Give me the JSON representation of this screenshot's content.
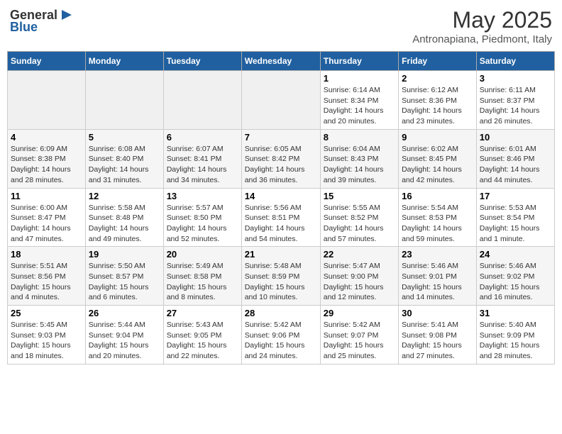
{
  "logo": {
    "line1": "General",
    "line2": "Blue"
  },
  "title": "May 2025",
  "subtitle": "Antronapiana, Piedmont, Italy",
  "weekdays": [
    "Sunday",
    "Monday",
    "Tuesday",
    "Wednesday",
    "Thursday",
    "Friday",
    "Saturday"
  ],
  "weeks": [
    [
      {
        "day": "",
        "info": ""
      },
      {
        "day": "",
        "info": ""
      },
      {
        "day": "",
        "info": ""
      },
      {
        "day": "",
        "info": ""
      },
      {
        "day": "1",
        "info": "Sunrise: 6:14 AM\nSunset: 8:34 PM\nDaylight: 14 hours and 20 minutes."
      },
      {
        "day": "2",
        "info": "Sunrise: 6:12 AM\nSunset: 8:36 PM\nDaylight: 14 hours and 23 minutes."
      },
      {
        "day": "3",
        "info": "Sunrise: 6:11 AM\nSunset: 8:37 PM\nDaylight: 14 hours and 26 minutes."
      }
    ],
    [
      {
        "day": "4",
        "info": "Sunrise: 6:09 AM\nSunset: 8:38 PM\nDaylight: 14 hours and 28 minutes."
      },
      {
        "day": "5",
        "info": "Sunrise: 6:08 AM\nSunset: 8:40 PM\nDaylight: 14 hours and 31 minutes."
      },
      {
        "day": "6",
        "info": "Sunrise: 6:07 AM\nSunset: 8:41 PM\nDaylight: 14 hours and 34 minutes."
      },
      {
        "day": "7",
        "info": "Sunrise: 6:05 AM\nSunset: 8:42 PM\nDaylight: 14 hours and 36 minutes."
      },
      {
        "day": "8",
        "info": "Sunrise: 6:04 AM\nSunset: 8:43 PM\nDaylight: 14 hours and 39 minutes."
      },
      {
        "day": "9",
        "info": "Sunrise: 6:02 AM\nSunset: 8:45 PM\nDaylight: 14 hours and 42 minutes."
      },
      {
        "day": "10",
        "info": "Sunrise: 6:01 AM\nSunset: 8:46 PM\nDaylight: 14 hours and 44 minutes."
      }
    ],
    [
      {
        "day": "11",
        "info": "Sunrise: 6:00 AM\nSunset: 8:47 PM\nDaylight: 14 hours and 47 minutes."
      },
      {
        "day": "12",
        "info": "Sunrise: 5:58 AM\nSunset: 8:48 PM\nDaylight: 14 hours and 49 minutes."
      },
      {
        "day": "13",
        "info": "Sunrise: 5:57 AM\nSunset: 8:50 PM\nDaylight: 14 hours and 52 minutes."
      },
      {
        "day": "14",
        "info": "Sunrise: 5:56 AM\nSunset: 8:51 PM\nDaylight: 14 hours and 54 minutes."
      },
      {
        "day": "15",
        "info": "Sunrise: 5:55 AM\nSunset: 8:52 PM\nDaylight: 14 hours and 57 minutes."
      },
      {
        "day": "16",
        "info": "Sunrise: 5:54 AM\nSunset: 8:53 PM\nDaylight: 14 hours and 59 minutes."
      },
      {
        "day": "17",
        "info": "Sunrise: 5:53 AM\nSunset: 8:54 PM\nDaylight: 15 hours and 1 minute."
      }
    ],
    [
      {
        "day": "18",
        "info": "Sunrise: 5:51 AM\nSunset: 8:56 PM\nDaylight: 15 hours and 4 minutes."
      },
      {
        "day": "19",
        "info": "Sunrise: 5:50 AM\nSunset: 8:57 PM\nDaylight: 15 hours and 6 minutes."
      },
      {
        "day": "20",
        "info": "Sunrise: 5:49 AM\nSunset: 8:58 PM\nDaylight: 15 hours and 8 minutes."
      },
      {
        "day": "21",
        "info": "Sunrise: 5:48 AM\nSunset: 8:59 PM\nDaylight: 15 hours and 10 minutes."
      },
      {
        "day": "22",
        "info": "Sunrise: 5:47 AM\nSunset: 9:00 PM\nDaylight: 15 hours and 12 minutes."
      },
      {
        "day": "23",
        "info": "Sunrise: 5:46 AM\nSunset: 9:01 PM\nDaylight: 15 hours and 14 minutes."
      },
      {
        "day": "24",
        "info": "Sunrise: 5:46 AM\nSunset: 9:02 PM\nDaylight: 15 hours and 16 minutes."
      }
    ],
    [
      {
        "day": "25",
        "info": "Sunrise: 5:45 AM\nSunset: 9:03 PM\nDaylight: 15 hours and 18 minutes."
      },
      {
        "day": "26",
        "info": "Sunrise: 5:44 AM\nSunset: 9:04 PM\nDaylight: 15 hours and 20 minutes."
      },
      {
        "day": "27",
        "info": "Sunrise: 5:43 AM\nSunset: 9:05 PM\nDaylight: 15 hours and 22 minutes."
      },
      {
        "day": "28",
        "info": "Sunrise: 5:42 AM\nSunset: 9:06 PM\nDaylight: 15 hours and 24 minutes."
      },
      {
        "day": "29",
        "info": "Sunrise: 5:42 AM\nSunset: 9:07 PM\nDaylight: 15 hours and 25 minutes."
      },
      {
        "day": "30",
        "info": "Sunrise: 5:41 AM\nSunset: 9:08 PM\nDaylight: 15 hours and 27 minutes."
      },
      {
        "day": "31",
        "info": "Sunrise: 5:40 AM\nSunset: 9:09 PM\nDaylight: 15 hours and 28 minutes."
      }
    ]
  ]
}
